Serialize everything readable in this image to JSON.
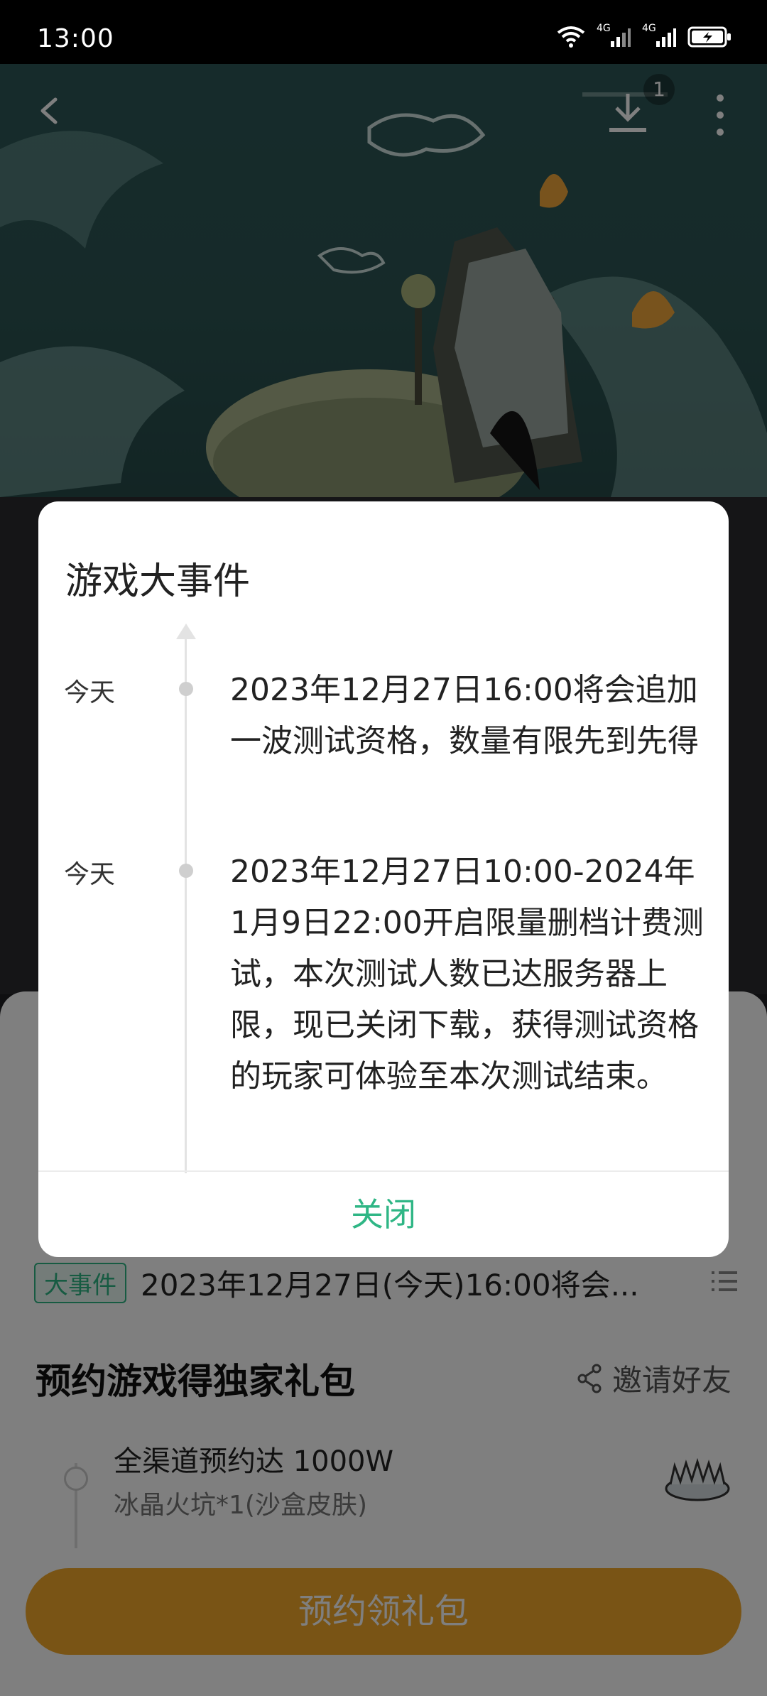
{
  "status_bar": {
    "time": "13:00",
    "net1": "4G",
    "net2": "4G"
  },
  "header": {
    "download_badge": "1"
  },
  "events_row": {
    "badge": "大事件",
    "text": "2023年12月27日(今天)16:00将会..."
  },
  "gift": {
    "title": "预约游戏得独家礼包",
    "invite": "邀请好友",
    "item_title": "全渠道预约达 1000W",
    "item_sub": "冰晶火坑*1(沙盒皮肤)"
  },
  "bottom": {
    "reserve": "预约领礼包"
  },
  "dialog": {
    "title": "游戏大事件",
    "events": [
      {
        "date": "今天",
        "text": "2023年12月27日16:00将会追加一波测试资格，数量有限先到先得"
      },
      {
        "date": "今天",
        "text": "2023年12月27日10:00-2024年1月9日22:00开启限量删档计费测试，本次测试人数已达服务器上限，现已关闭下载，获得测试资格的玩家可体验至本次测试结束。"
      }
    ],
    "close": "关闭"
  },
  "colors": {
    "accent": "#2fb685",
    "button": "#f2a92a"
  }
}
